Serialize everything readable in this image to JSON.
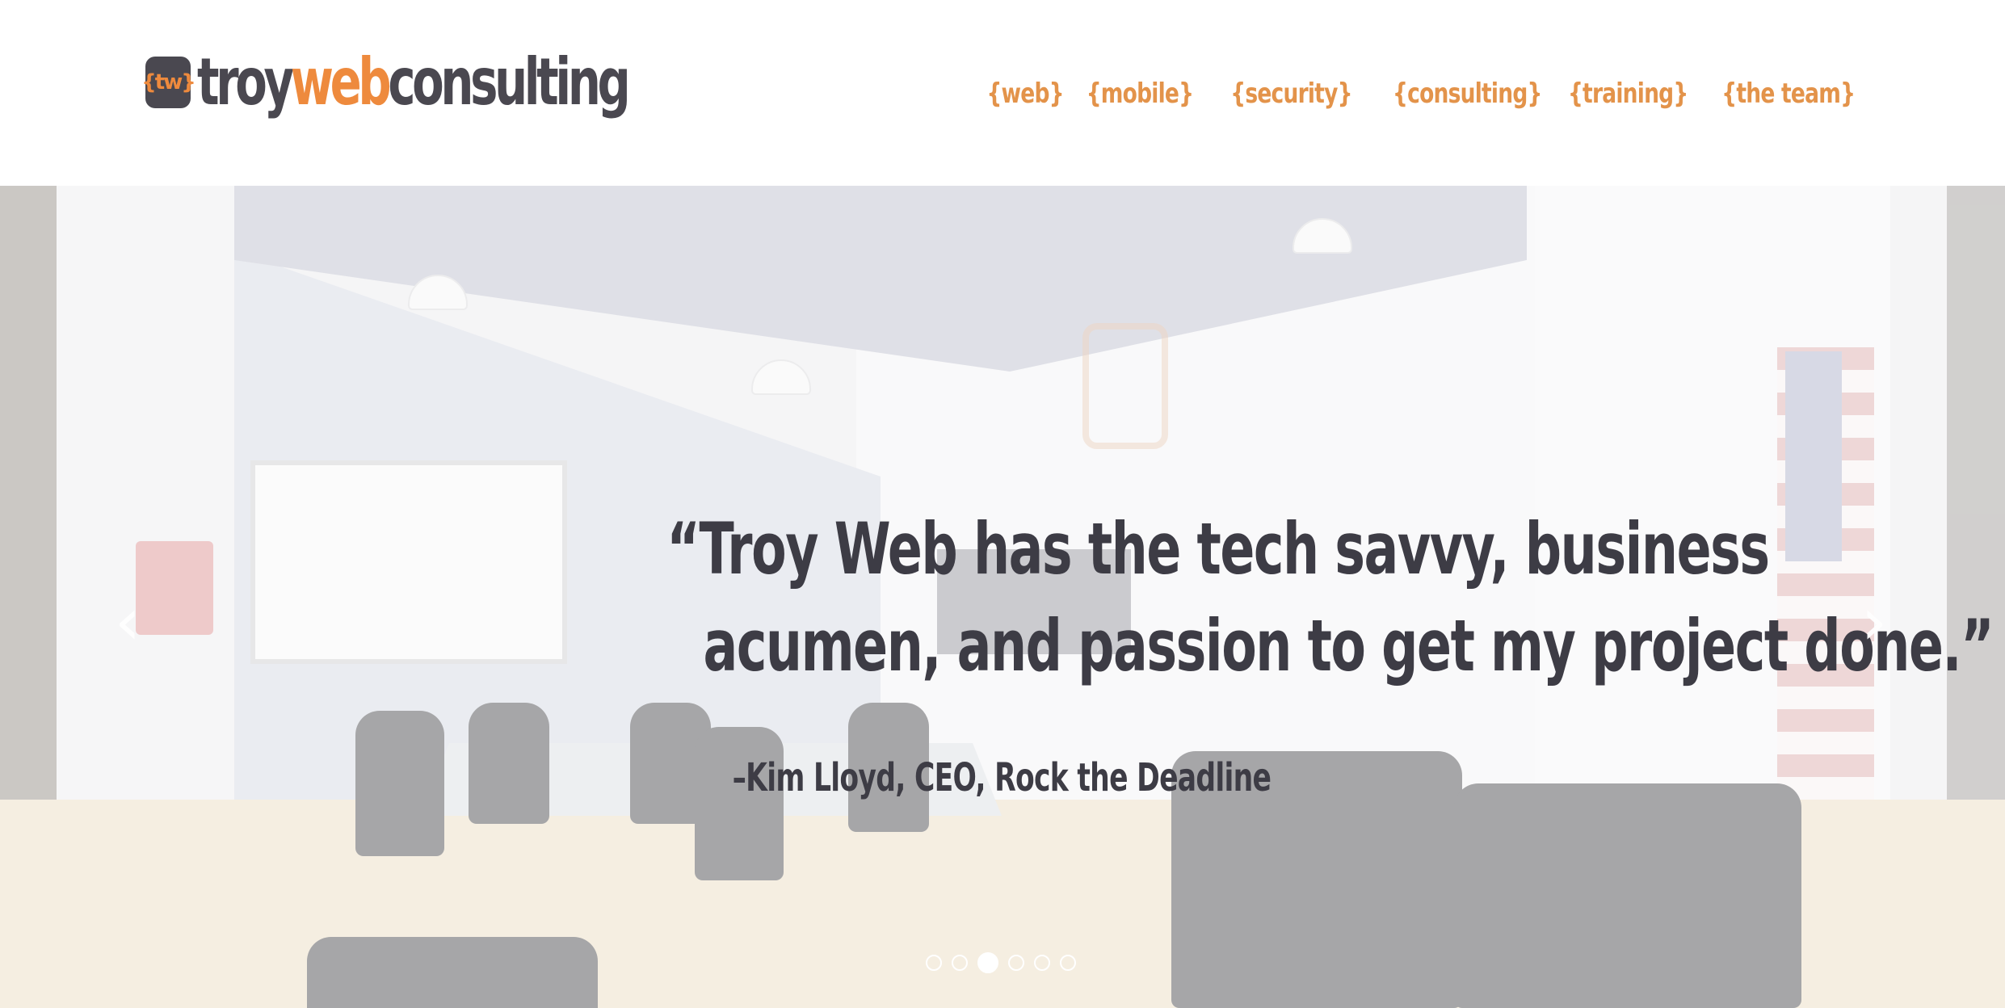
{
  "header": {
    "logo": {
      "badge_text": "{tw}",
      "word_troy": "troy",
      "word_web": "web",
      "word_consulting": "consulting"
    },
    "nav": [
      {
        "label": "{web}"
      },
      {
        "label": "{mobile}"
      },
      {
        "label": "{security}"
      },
      {
        "label": "{consulting}"
      },
      {
        "label": "{training}"
      },
      {
        "label": "{the team}"
      }
    ]
  },
  "hero": {
    "quote_line_1": "“Troy Web has the tech savvy, business",
    "quote_line_2": "acumen, and passion to get my project done.”",
    "attribution": "–Kim Lloyd, CEO, Rock the Deadline",
    "prev_arrow": "‹",
    "next_arrow": "›",
    "slides_count": 6,
    "active_slide": 3
  },
  "colors": {
    "brand_orange": "#ee8a3d",
    "brand_dark": "#4a4850",
    "nav_orange": "#e3934a",
    "quote_text": "#3d3c45"
  },
  "icons": {
    "prev": "chevron-left-icon",
    "next": "chevron-right-icon"
  }
}
